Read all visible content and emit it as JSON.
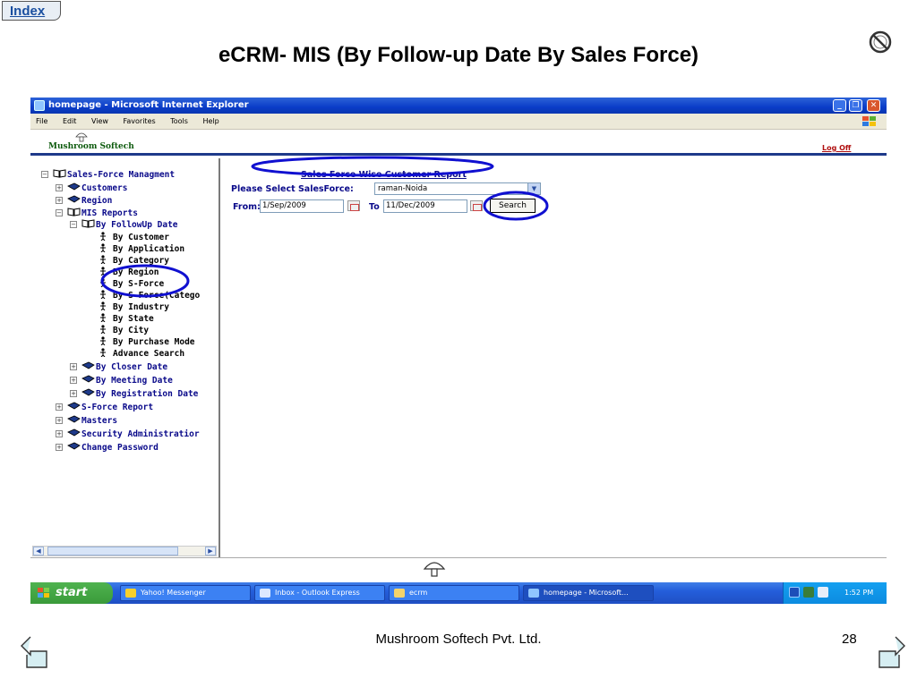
{
  "slide": {
    "index_label": "Index",
    "title": "eCRM- MIS (By Follow-up Date By Sales Force)",
    "footer": "Mushroom Softech Pvt. Ltd.",
    "page_number": "28"
  },
  "window": {
    "title": "homepage - Microsoft Internet Explorer",
    "menu": [
      "File",
      "Edit",
      "View",
      "Favorites",
      "Tools",
      "Help"
    ],
    "buttons": [
      "_",
      "❐",
      "✕"
    ]
  },
  "app": {
    "brand": "Mushroom Softech",
    "logoff": "Log Off"
  },
  "tree": {
    "root": "Sales-Force Managment",
    "customers": "Customers",
    "region": "Region",
    "mis": "MIS Reports",
    "by_followup": "By FollowUp Date",
    "leaves": [
      "By Customer",
      "By Application",
      "By Category",
      "By Region",
      "By S-Force",
      "By S-Force(Catego",
      "By Industry",
      "By State",
      "By City",
      "By Purchase Mode",
      "Advance Search"
    ],
    "by_closer": "By Closer Date",
    "by_meeting": "By Meeting Date",
    "by_registration": "By Registration Date",
    "sforce_report": "S-Force Report",
    "masters": "Masters",
    "security": "Security Administratior",
    "change_password": "Change Password"
  },
  "form": {
    "report_title": "Sales Force Wise Customer Report",
    "salesforce_label": "Please Select SalesForce:",
    "salesforce_value": "raman-Noida",
    "from_label": "From:",
    "from_value": "1/Sep/2009",
    "to_label": "To",
    "to_value": "11/Dec/2009",
    "search_label": "Search"
  },
  "taskbar": {
    "start": "start",
    "tasks": [
      "Yahoo! Messenger",
      "Inbox - Outlook Express",
      "ecrm",
      "homepage - Microsoft..."
    ],
    "clock": "1:52 PM"
  },
  "colors": {
    "highlight": "#1010d0",
    "link": "#0a0a8a",
    "titlebar": "#0a3cc8",
    "taskbar": "#245edb"
  }
}
